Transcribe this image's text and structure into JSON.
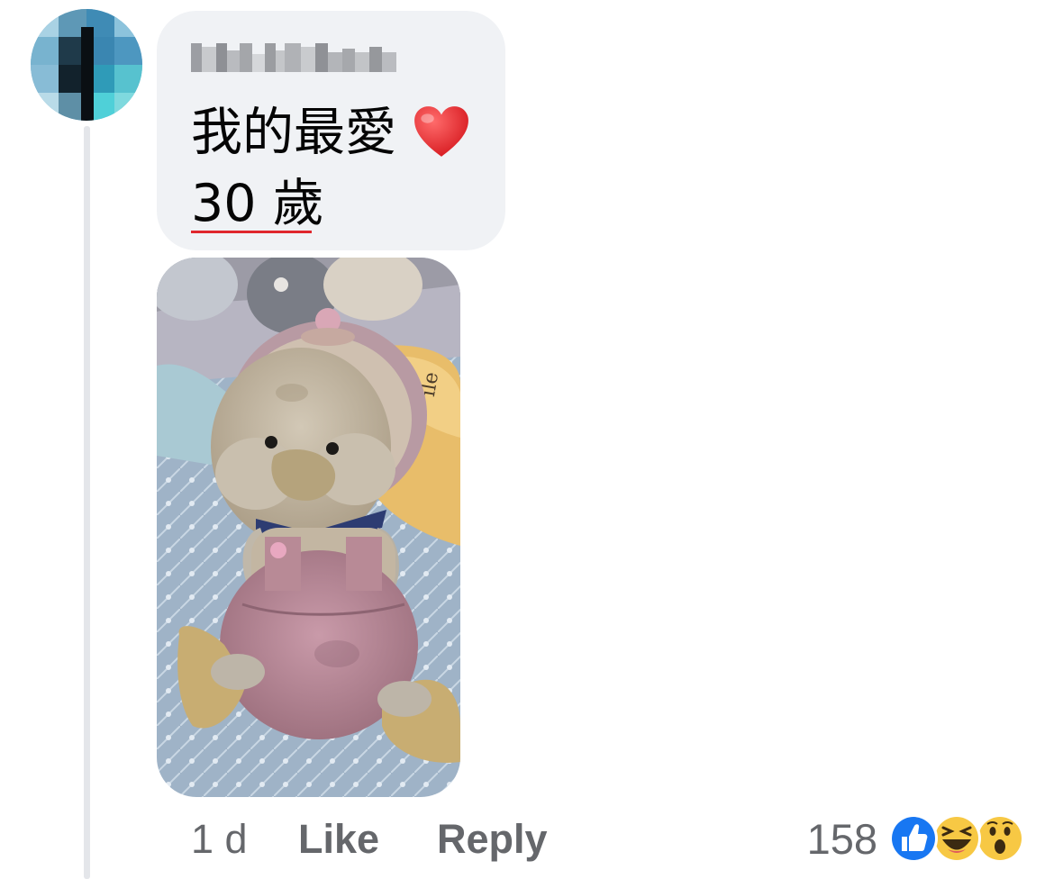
{
  "comment": {
    "author": "M-I Chen",
    "text_line1": "我的最愛",
    "text_line2": "30 歲",
    "heart_icon": "red-heart-emoji"
  },
  "actions": {
    "time": "1 d",
    "like_label": "Like",
    "reply_label": "Reply"
  },
  "reactions": {
    "count": "158",
    "types": [
      "like",
      "haha",
      "wow"
    ]
  },
  "colors": {
    "bubble_bg": "#f0f2f5",
    "text": "#050505",
    "secondary_text": "#65676b",
    "like_blue": "#1877f2",
    "spell_underline": "#e0272d"
  }
}
